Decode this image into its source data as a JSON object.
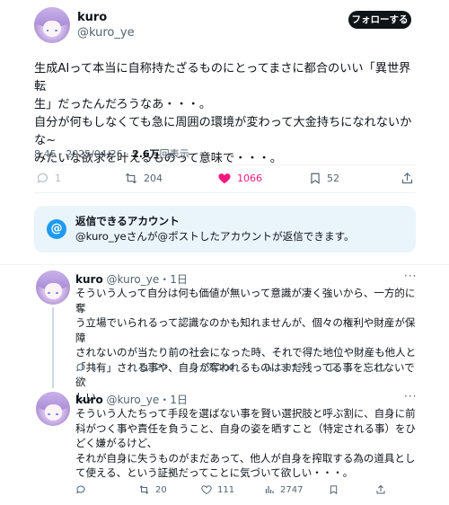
{
  "tweet": {
    "name": "kuro",
    "handle": "@kuro_ye",
    "follow_label": "フォローする",
    "lines": [
      "生成AIって本当に自称持たざるものにとってまさに都合のいい「異世界転",
      "生」だったんだろうなあ・・・。",
      "自分が何もしなくても急に周囲の環境が変わって大金持ちになれないかな~",
      "みたいな欲求を叶えるものって意味で・・・。"
    ],
    "time": "8:45 · 2025/04/26 · ",
    "views_value": "2.6万",
    "views_label": "回表示",
    "actions": {
      "replies": "1",
      "reposts": "204",
      "likes": "1066",
      "bookmarks": "52"
    },
    "like_color": "#f91880"
  },
  "reply_notice": {
    "title": "返信できるアカウント",
    "body": "@kuro_yeさんが@ポストしたアカウントが返信できます。",
    "icon": "@"
  },
  "replies": [
    {
      "name": "kuro",
      "handle_time": "@kuro_ye・1日",
      "lines": [
        "そういう人って自分は何も価値が無いって意識が凄く強いから、一方的に奪",
        "う立場でいられるって認識なのかも知れませんが、個々の権利や財産が保障",
        "されないのが当たり前の社会になった時、それで得た地位や財産も他人と",
        "「共有」される事や、自身が奪われるものはまだ残ってる事を忘れないで欲",
        "しい"
      ],
      "actions": {
        "replies": "1",
        "reposts": "20",
        "likes": "106",
        "views": "3052"
      }
    },
    {
      "name": "kuro",
      "handle_time": "@kuro_ye・1日",
      "lines": [
        "そういう人たちって手段を選ばない事を賢い選択肢と呼ぶ割に、自身に前",
        "科がつく事や責任を負うこと、自身の姿を晒すこと（特定される事）をひ",
        "どく嫌がるけど、",
        "それが自身に失うものがまだあって、他人が自身を搾取する為の道具とし",
        "て使える、という証拠だってことに気づいて欲しい・・・。"
      ],
      "actions": {
        "replies": "",
        "reposts": "20",
        "likes": "111",
        "views": "2747"
      }
    }
  ]
}
